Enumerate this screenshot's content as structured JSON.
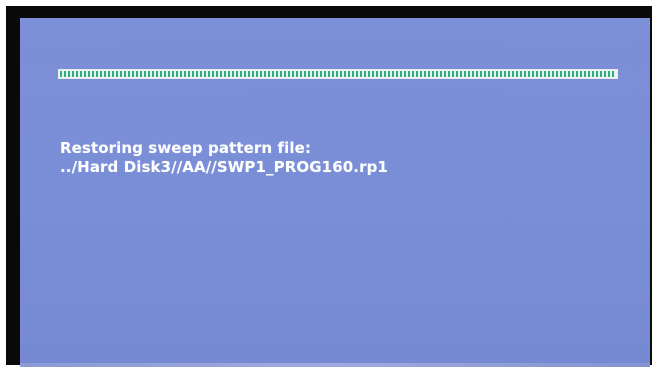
{
  "screen": {
    "background_color": "#7b8ed6"
  },
  "progress": {
    "fraction": 1.0,
    "fill_color": "#2fae83"
  },
  "status": {
    "line1": "Restoring sweep pattern file:",
    "line2": "../Hard Disk3//AA//SWP1_PROG160.rp1"
  }
}
